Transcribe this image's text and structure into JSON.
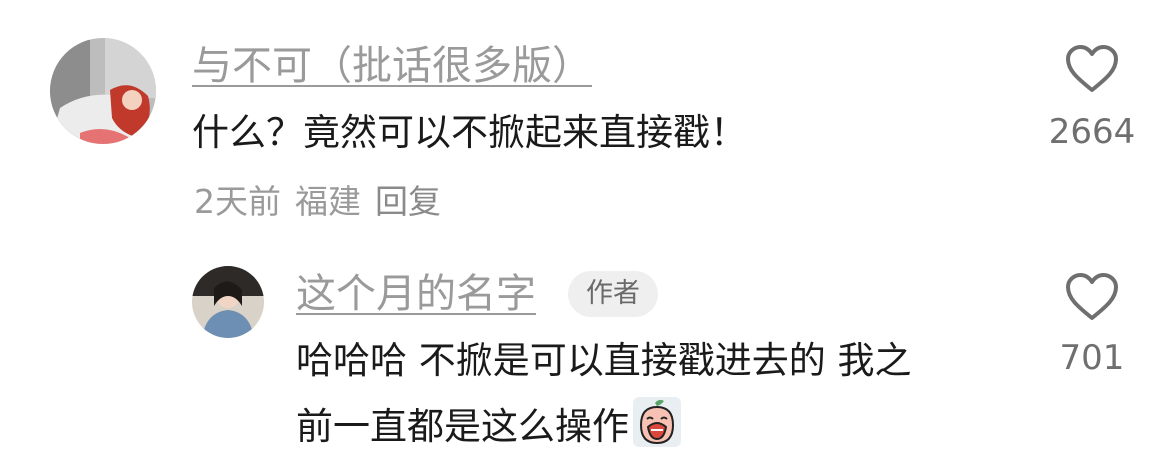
{
  "comments": [
    {
      "username": "与不可（批话很多版）",
      "text": "什么？竟然可以不掀起来直接戳！",
      "meta": {
        "time": "2天前",
        "location": "福建",
        "reply_label": "回复"
      },
      "likes": "2664",
      "icons": {
        "like": "heart-outline-icon"
      }
    }
  ],
  "reply": {
    "username": "这个月的名字",
    "badge": "作者",
    "text_line1": "哈哈哈 不掀是可以直接戳进去的 我之",
    "text_line2": "前一直都是这么操作",
    "emoji": "crying-peach-emoji",
    "likes": "701",
    "icons": {
      "like": "heart-outline-icon"
    }
  },
  "colors": {
    "secondary_text": "#9a9a9a",
    "badge_bg": "#efefef",
    "primary_text": "#1a1a1a"
  }
}
